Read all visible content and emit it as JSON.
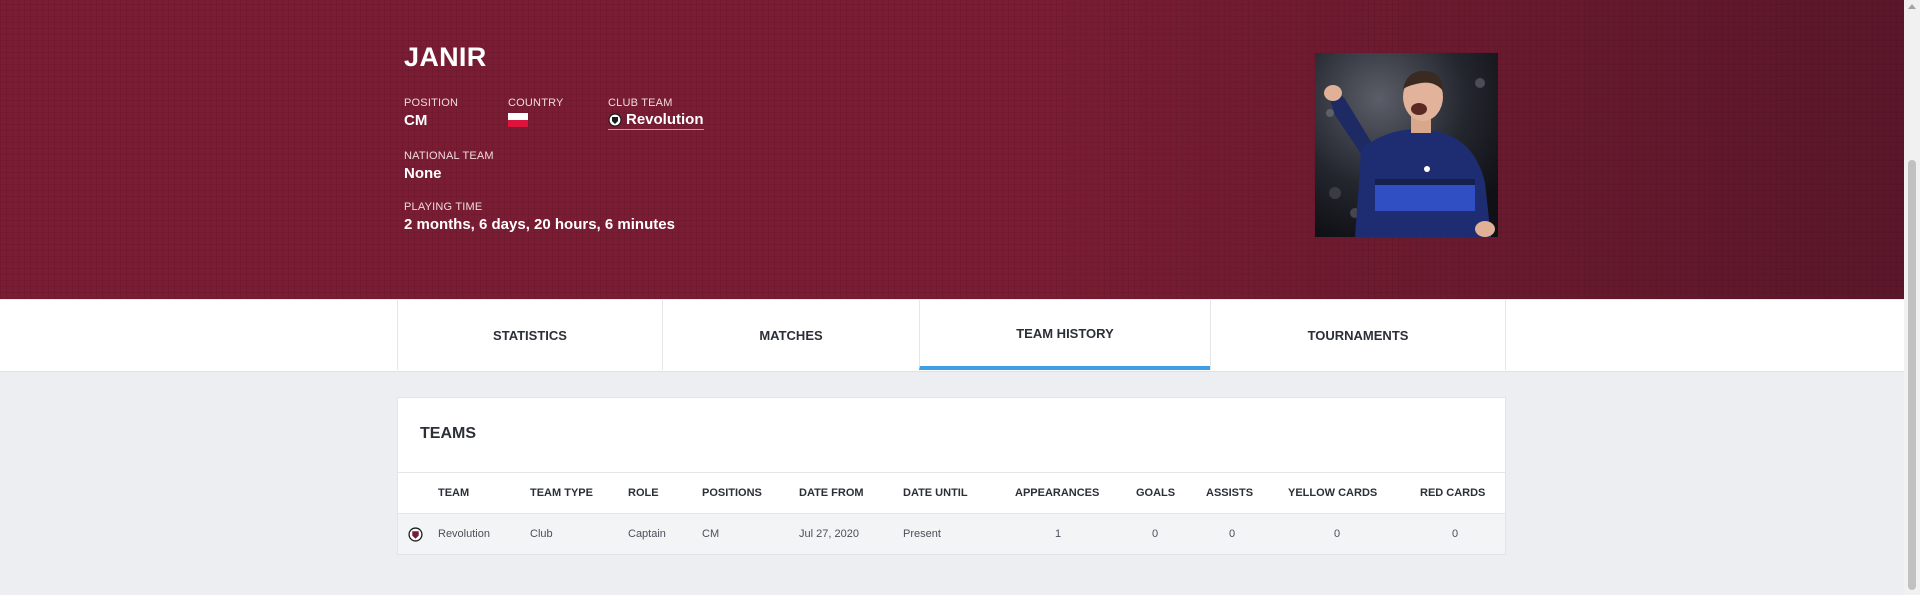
{
  "player": {
    "name": "JANIR",
    "position_label": "POSITION",
    "position": "CM",
    "country_label": "COUNTRY",
    "country_flag_icon": "poland-flag-icon",
    "club_label": "CLUB TEAM",
    "club": "Revolution",
    "national_label": "NATIONAL TEAM",
    "national": "None",
    "playing_time_label": "PLAYING TIME",
    "playing_time": "2 months, 6 days, 20 hours, 6 minutes"
  },
  "colors": {
    "hero_bg": "#7a1c33",
    "active_tab_underline": "#3f9fe6",
    "page_bg": "#eceef1"
  },
  "tabs": [
    {
      "label": "STATISTICS",
      "active": false
    },
    {
      "label": "MATCHES",
      "active": false
    },
    {
      "label": "TEAM HISTORY",
      "active": true
    },
    {
      "label": "TOURNAMENTS",
      "active": false
    }
  ],
  "teams": {
    "title": "TEAMS",
    "columns": [
      "TEAM",
      "TEAM TYPE",
      "ROLE",
      "POSITIONS",
      "DATE FROM",
      "DATE UNTIL",
      "APPEARANCES",
      "GOALS",
      "ASSISTS",
      "YELLOW CARDS",
      "RED CARDS"
    ],
    "rows": [
      {
        "logo_icon": "club-crest-icon",
        "team": "Revolution",
        "team_type": "Club",
        "role": "Captain",
        "positions": "CM",
        "date_from": "Jul 27, 2020",
        "date_until": "Present",
        "appearances": "1",
        "goals": "0",
        "assists": "0",
        "yellow_cards": "0",
        "red_cards": "0"
      }
    ]
  }
}
